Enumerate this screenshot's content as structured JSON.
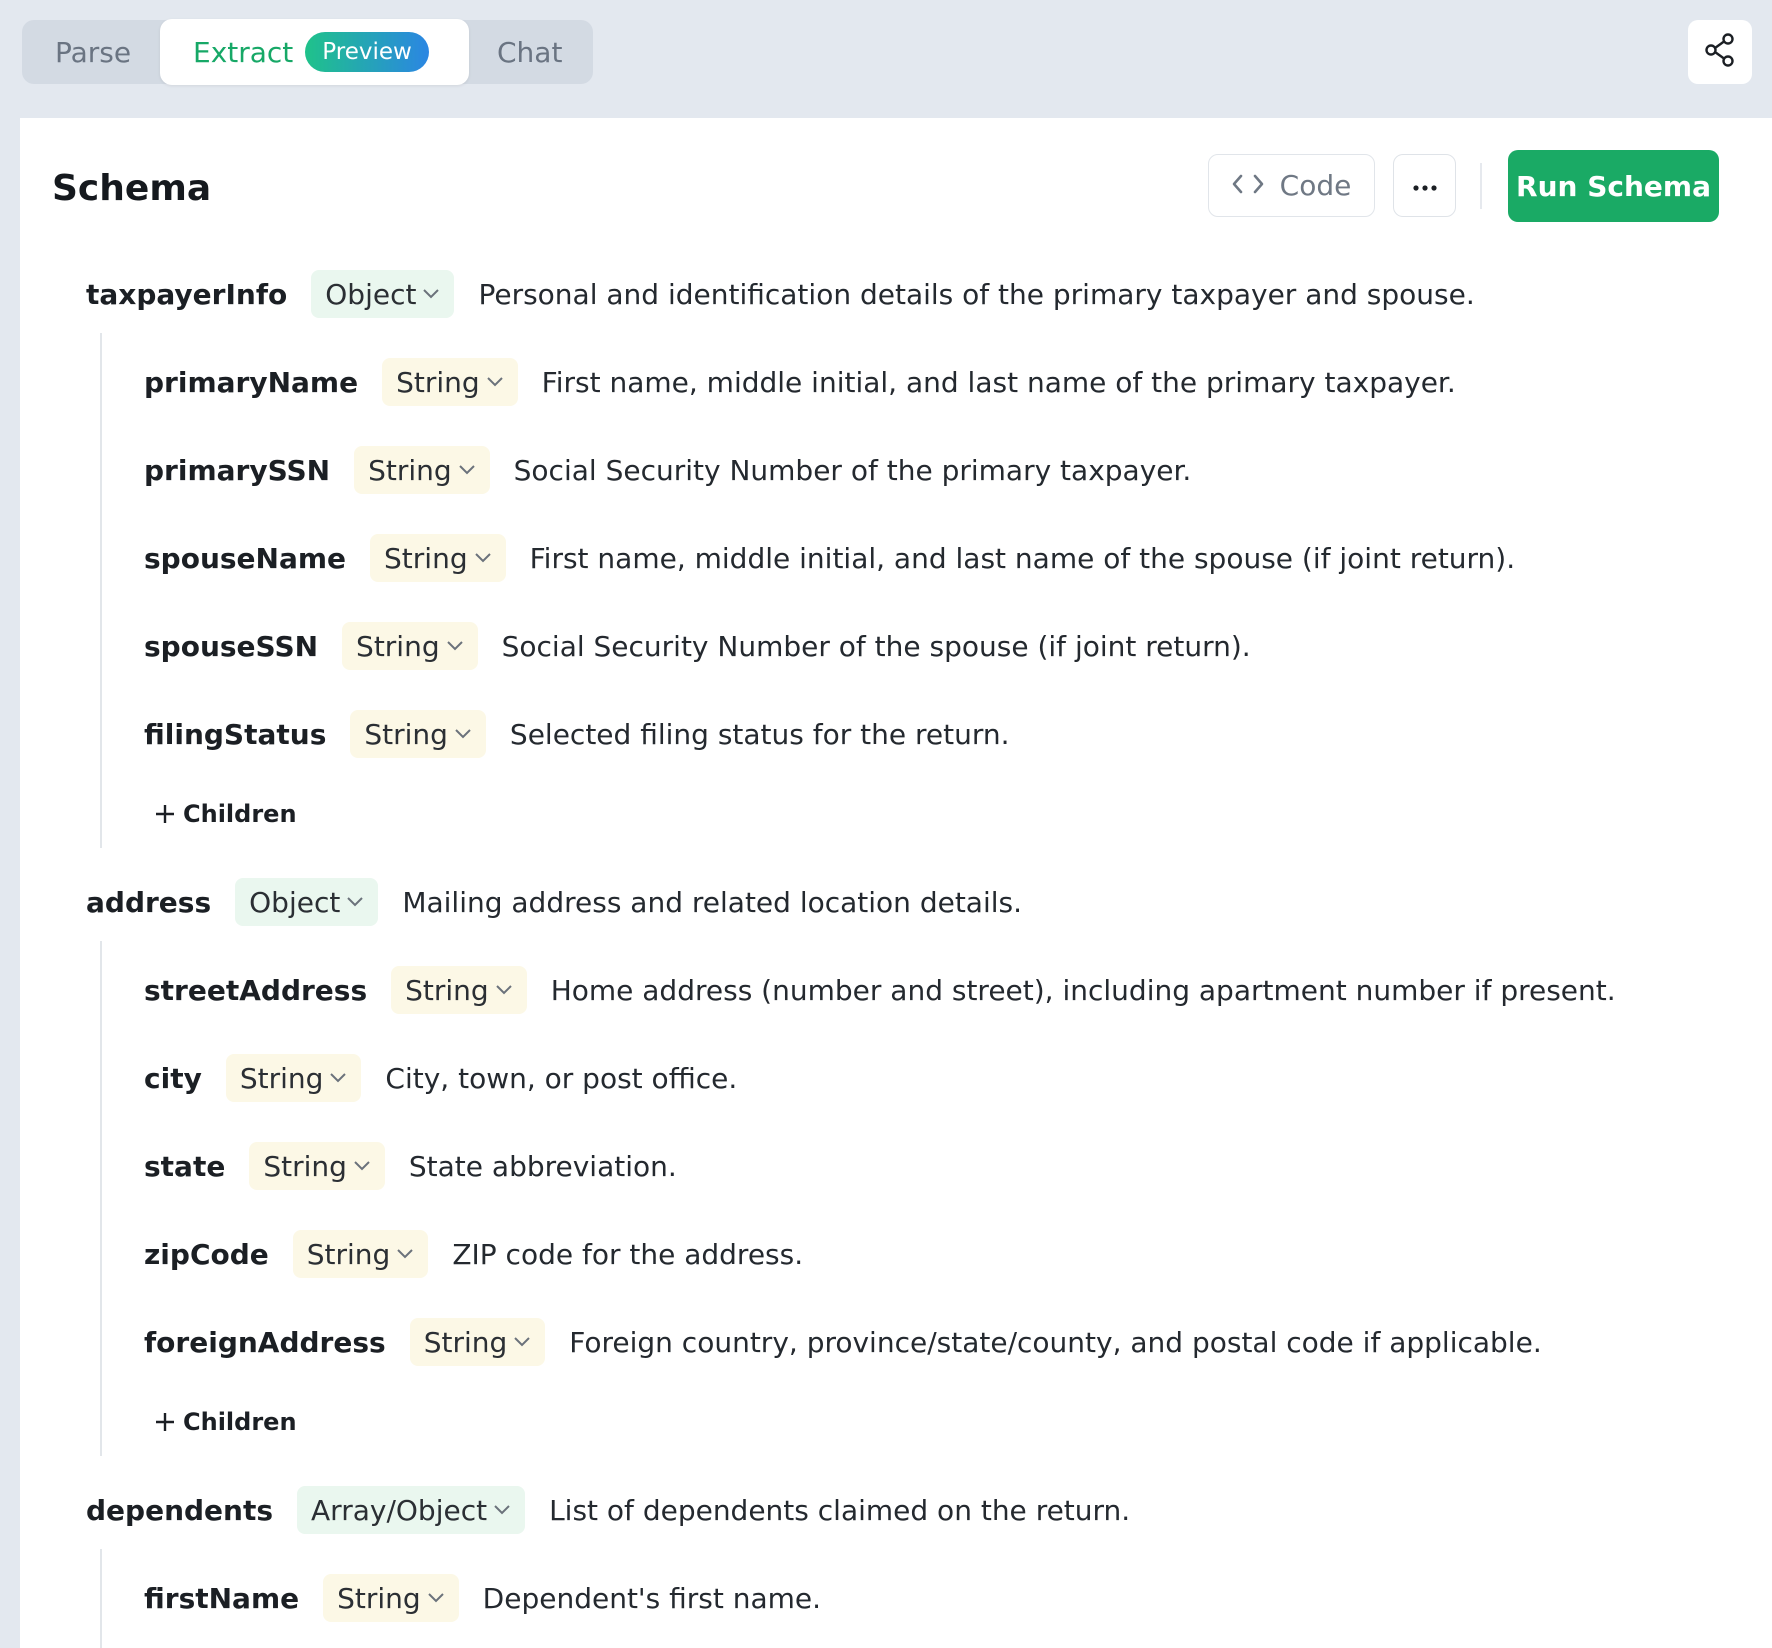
{
  "tabs": {
    "parse": "Parse",
    "extract": "Extract",
    "extract_badge": "Preview",
    "chat": "Chat"
  },
  "toolbar": {
    "title": "Schema",
    "code_label": "Code",
    "run_label": "Run Schema"
  },
  "colors": {
    "accent_green": "#1aaa65",
    "object_pill_bg": "#eaf7ef",
    "string_pill_bg": "#fcf8e6"
  },
  "icons": [
    "share-icon",
    "code-icon",
    "more-icon",
    "chevron-down-icon",
    "plus-icon"
  ],
  "schema": [
    {
      "name": "taxpayerInfo",
      "type": "Object",
      "description": "Personal and identification details of the primary taxpayer and spouse.",
      "children": [
        {
          "name": "primaryName",
          "type": "String",
          "description": "First name, middle initial, and last name of the primary taxpayer."
        },
        {
          "name": "primarySSN",
          "type": "String",
          "description": "Social Security Number of the primary taxpayer."
        },
        {
          "name": "spouseName",
          "type": "String",
          "description": "First name, middle initial, and last name of the spouse (if joint return)."
        },
        {
          "name": "spouseSSN",
          "type": "String",
          "description": "Social Security Number of the spouse (if joint return)."
        },
        {
          "name": "filingStatus",
          "type": "String",
          "description": "Selected filing status for the return."
        }
      ],
      "add_children_label": "Children"
    },
    {
      "name": "address",
      "type": "Object",
      "description": "Mailing address and related location details.",
      "children": [
        {
          "name": "streetAddress",
          "type": "String",
          "description": "Home address (number and street), including apartment number if present."
        },
        {
          "name": "city",
          "type": "String",
          "description": "City, town, or post office."
        },
        {
          "name": "state",
          "type": "String",
          "description": "State abbreviation."
        },
        {
          "name": "zipCode",
          "type": "String",
          "description": "ZIP code for the address."
        },
        {
          "name": "foreignAddress",
          "type": "String",
          "description": "Foreign country, province/state/county, and postal code if applicable."
        }
      ],
      "add_children_label": "Children"
    },
    {
      "name": "dependents",
      "type": "Array/Object",
      "description": "List of dependents claimed on the return.",
      "children": [
        {
          "name": "firstName",
          "type": "String",
          "description": "Dependent's first name."
        }
      ]
    }
  ]
}
